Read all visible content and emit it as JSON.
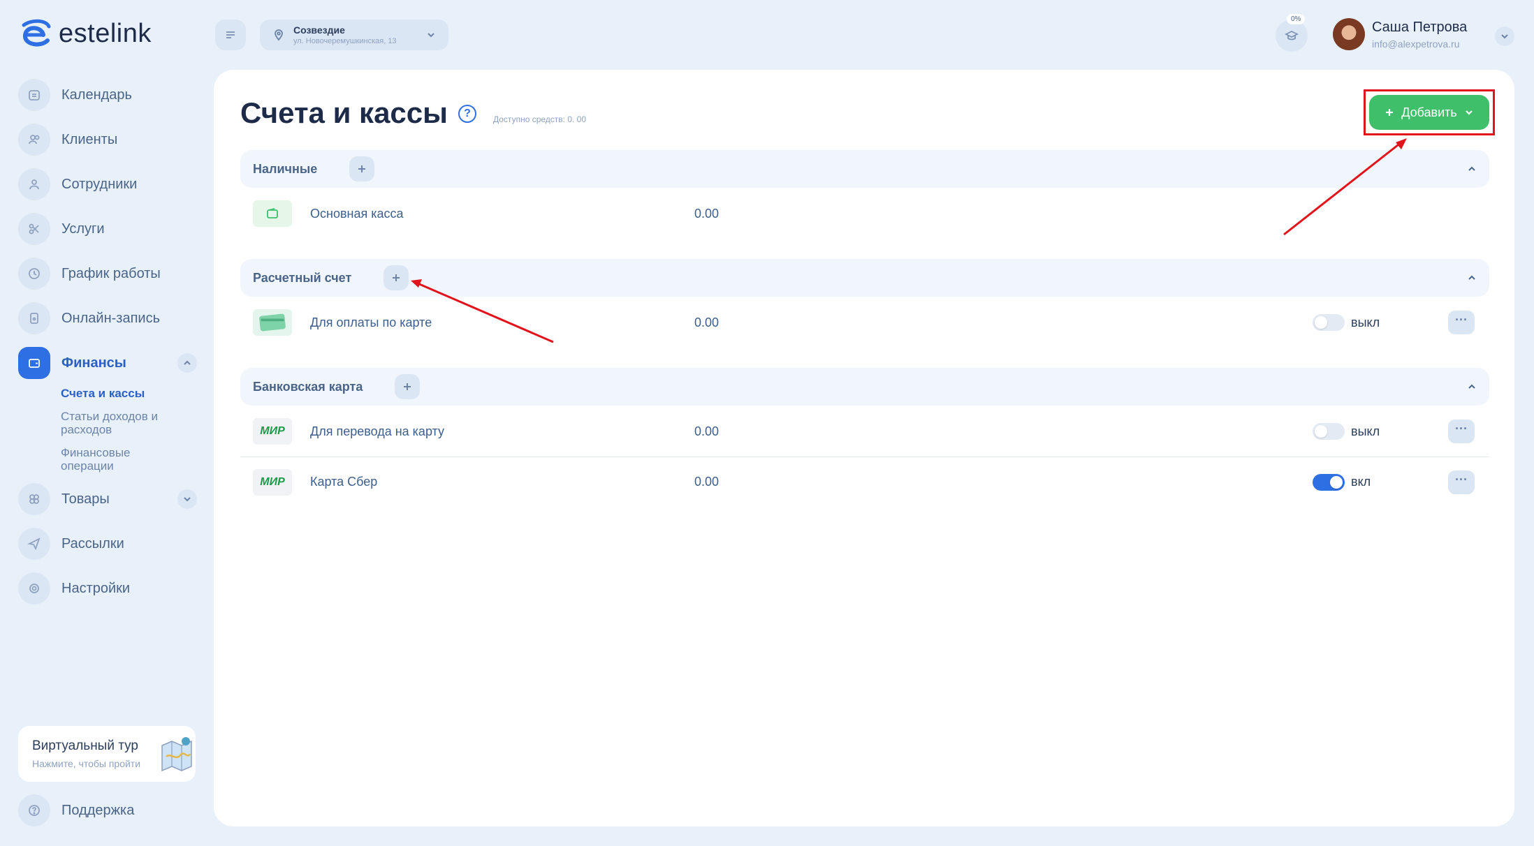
{
  "app": {
    "logo_text": "estelink"
  },
  "sidebar": {
    "items": [
      {
        "label": "Календарь",
        "icon": "calendar-icon"
      },
      {
        "label": "Клиенты",
        "icon": "clients-icon"
      },
      {
        "label": "Сотрудники",
        "icon": "staff-icon"
      },
      {
        "label": "Услуги",
        "icon": "scissors-icon"
      },
      {
        "label": "График работы",
        "icon": "clock-icon"
      },
      {
        "label": "Онлайн-запись",
        "icon": "phone-icon"
      },
      {
        "label": "Финансы",
        "icon": "wallet-icon"
      },
      {
        "label": "Товары",
        "icon": "goods-icon"
      },
      {
        "label": "Рассылки",
        "icon": "send-icon"
      },
      {
        "label": "Настройки",
        "icon": "gear-icon"
      }
    ],
    "finance_sub": [
      {
        "label": "Счета и кассы"
      },
      {
        "label": "Статьи доходов и расходов"
      },
      {
        "label": "Финансовые операции"
      }
    ],
    "tour": {
      "title": "Виртуальный тур",
      "subtitle": "Нажмите, чтобы пройти"
    },
    "support_label": "Поддержка"
  },
  "header": {
    "branch_name": "Созвездие",
    "branch_address": "ул. Новочеремушкинская, 13",
    "progress": "0%",
    "user_name": "Саша Петрова",
    "user_email": "info@alexpetrova.ru"
  },
  "page": {
    "title": "Счета и кассы",
    "available": "Доступно средств: 0. 00",
    "add_label": "Добавить"
  },
  "sections": [
    {
      "name": "Наличные",
      "rows": [
        {
          "name": "Основная касса",
          "amount": "0.00",
          "icon": "wallet-icon"
        }
      ]
    },
    {
      "name": "Расчетный счет",
      "rows": [
        {
          "name": "Для оплаты по карте",
          "amount": "0.00",
          "icon": "card-icon",
          "toggle_label": "выкл",
          "on": false
        }
      ]
    },
    {
      "name": "Банковская карта",
      "rows": [
        {
          "name": "Для перевода на карту",
          "amount": "0.00",
          "icon": "mir-logo",
          "logo_text": "МИР",
          "toggle_label": "выкл",
          "on": false
        },
        {
          "name": "Карта Сбер",
          "amount": "0.00",
          "icon": "mir-logo",
          "logo_text": "МИР",
          "toggle_label": "вкл",
          "on": true
        }
      ]
    }
  ],
  "colors": {
    "accent": "#2f6fe4",
    "success": "#3fbf6a",
    "annotation": "#e0141a"
  }
}
